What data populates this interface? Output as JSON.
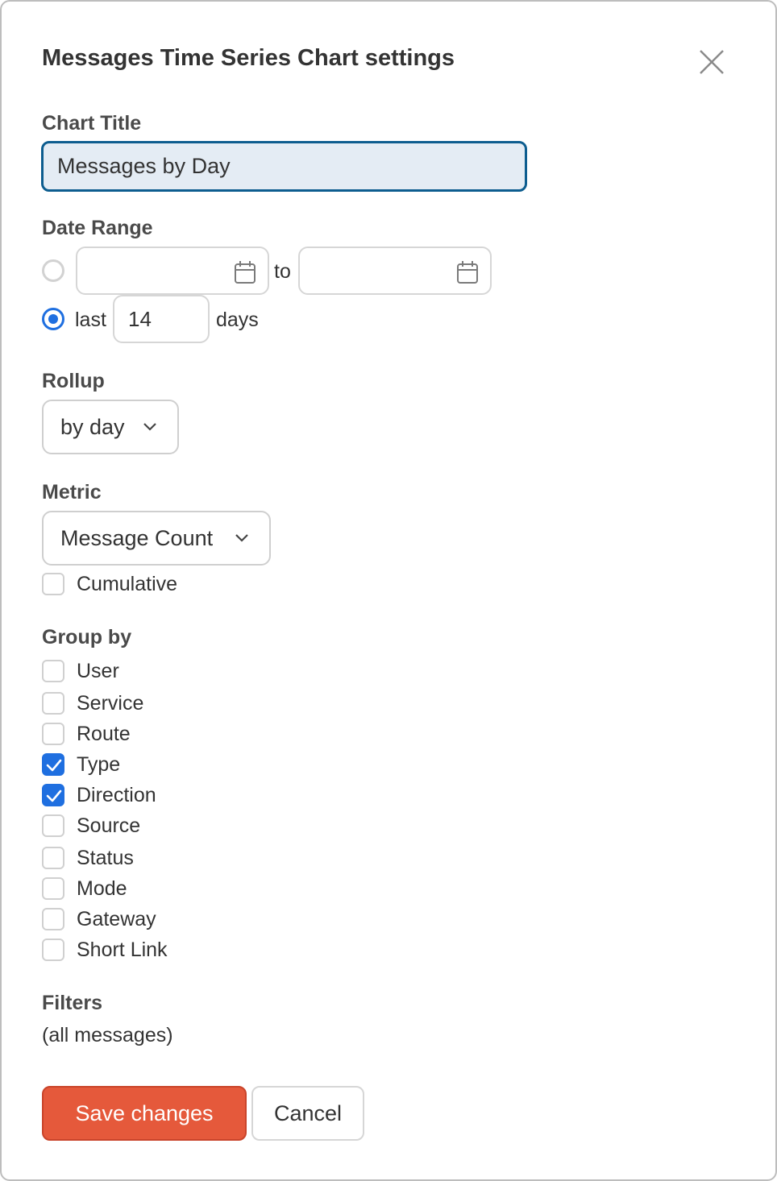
{
  "dialog": {
    "title": "Messages Time Series Chart settings",
    "close_icon": "close-icon"
  },
  "chart_title": {
    "label": "Chart Title",
    "value": "Messages by Day"
  },
  "date_range": {
    "label": "Date Range",
    "mode": "last_n_days",
    "from_value": "",
    "to_label": "to",
    "to_value": "",
    "calendar_icon": "calendar-icon",
    "last_label": "last",
    "days_value": "14",
    "days_label": "days"
  },
  "rollup": {
    "label": "Rollup",
    "selected": "by day",
    "chevron_icon": "chevron-down-icon"
  },
  "metric": {
    "label": "Metric",
    "selected": "Message Count",
    "cumulative_label": "Cumulative",
    "cumulative_checked": false
  },
  "group_by": {
    "label": "Group by",
    "options": [
      {
        "label": "User",
        "checked": false
      },
      {
        "label": "Service",
        "checked": false
      },
      {
        "label": "Route",
        "checked": false
      },
      {
        "label": "Type",
        "checked": true
      },
      {
        "label": "Direction",
        "checked": true
      },
      {
        "label": "Source",
        "checked": false
      },
      {
        "label": "Status",
        "checked": false
      },
      {
        "label": "Mode",
        "checked": false
      },
      {
        "label": "Gateway",
        "checked": false
      },
      {
        "label": "Short Link",
        "checked": false
      }
    ]
  },
  "filters": {
    "label": "Filters",
    "value": "(all messages)"
  },
  "actions": {
    "save_label": "Save changes",
    "cancel_label": "Cancel"
  },
  "colors": {
    "accent_blue": "#1f6fe0",
    "input_focus": "#0d5d8f",
    "save_button": "#e5593b"
  }
}
